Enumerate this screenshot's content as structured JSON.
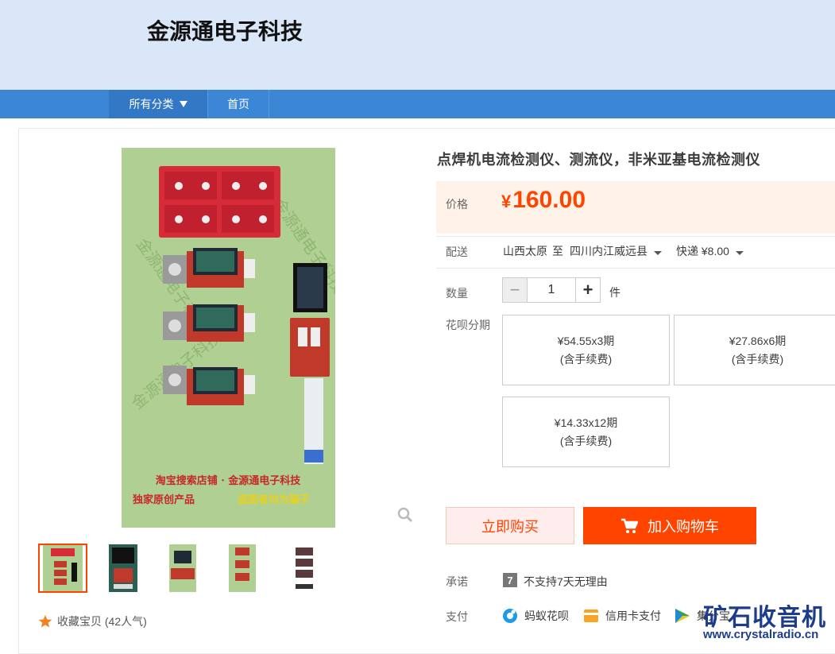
{
  "shop": {
    "name": "金源通电子科技"
  },
  "nav": {
    "category_label": "所有分类",
    "home_label": "首页"
  },
  "gallery": {
    "main_image": {
      "watermark": "金源通电子科技",
      "caption_line1": "淘宝搜索店铺 · 金源通电子科技",
      "caption_line2": "独家原创产品",
      "caption_line2_highlight": "盗图者均为骗子"
    },
    "favorite": {
      "label": "收藏宝贝 (42人气)"
    }
  },
  "product": {
    "title": "点焊机电流检测仪、测流仪，非米亚基电流检测仪",
    "price_label": "价格",
    "price_currency": "¥",
    "price_value": "160.00",
    "shipping": {
      "label": "配送",
      "origin": "山西太原",
      "to": "至",
      "destination": "四川内江威远县",
      "method": "快递 ¥8.00"
    },
    "quantity": {
      "label": "数量",
      "minus": "−",
      "value": "1",
      "plus": "+",
      "unit": "件"
    },
    "installments": {
      "label": "花呗分期",
      "options": [
        {
          "amount": "¥54.55x3期",
          "note": "(含手续费)"
        },
        {
          "amount": "¥27.86x6期",
          "note": "(含手续费)"
        },
        {
          "amount": "¥14.33x12期",
          "note": "(含手续费)"
        }
      ]
    },
    "buy_now_label": "立即购买",
    "add_to_cart_label": "加入购物车",
    "promise": {
      "label": "承诺",
      "icon_text": "7",
      "text": "不支持7天无理由"
    },
    "payment": {
      "label": "支付",
      "methods": [
        "蚂蚁花呗",
        "信用卡支付",
        "集分宝"
      ]
    }
  },
  "watermark": {
    "title": "矿石收音机",
    "url": "www.crystalradio.cn"
  },
  "colors": {
    "accent": "#ff4400",
    "nav": "#3b86d5",
    "header_bg": "#d9e7f8",
    "price_bg": "#fff2e8"
  }
}
